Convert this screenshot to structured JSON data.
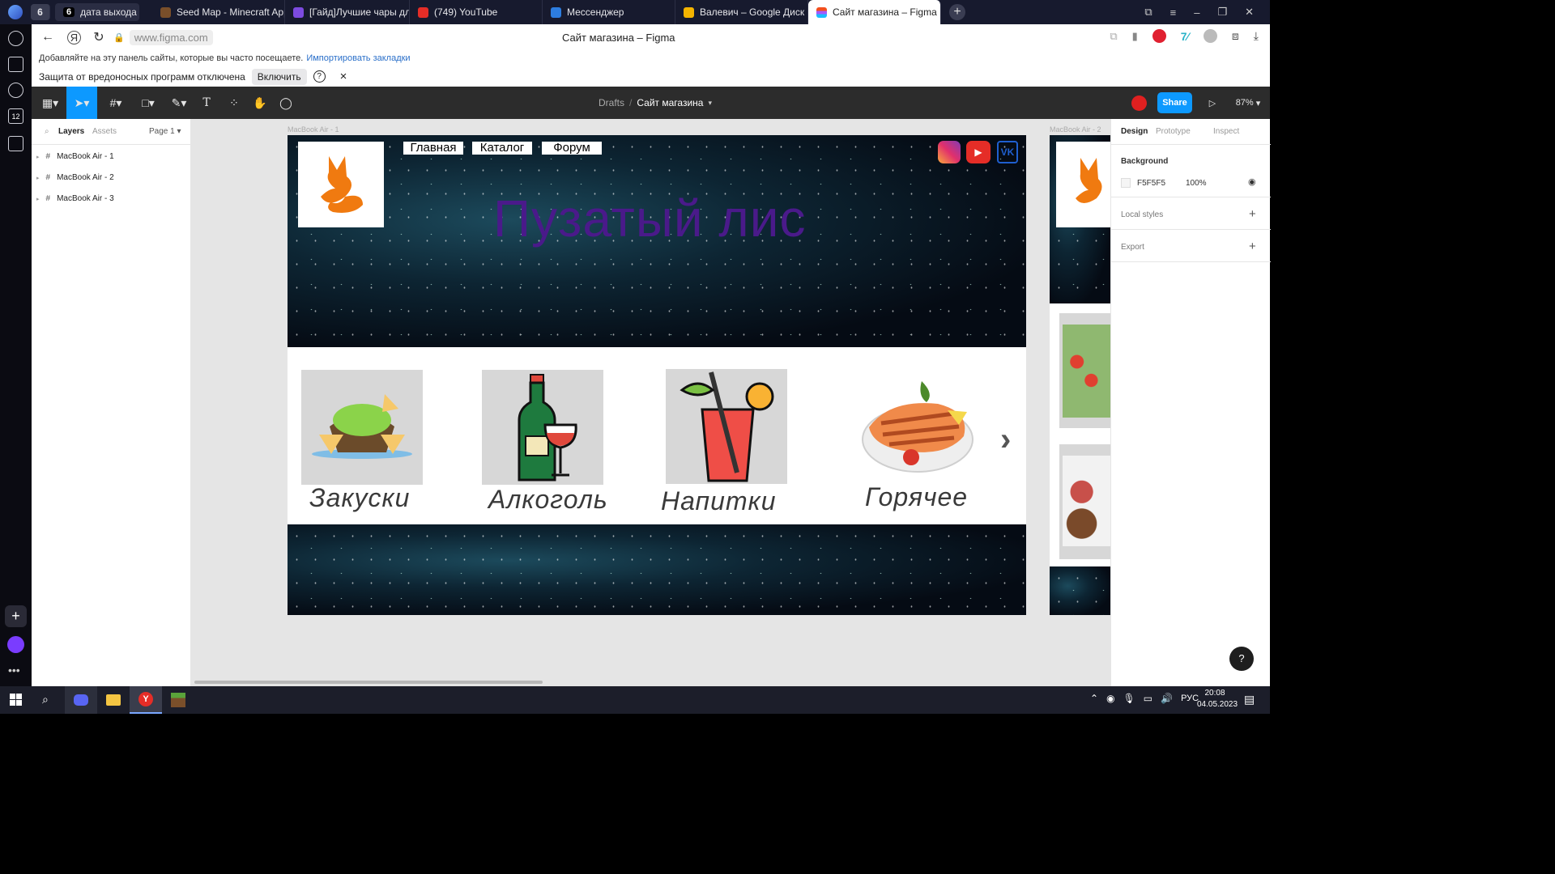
{
  "tabs": [
    {
      "label": "6",
      "fav": "#ffffff"
    },
    {
      "label": "дата выхода",
      "count": "6"
    },
    {
      "label": "Seed Map - Minecraft App",
      "fav": "#7a4f2a"
    },
    {
      "label": "[Гайд]Лучшие чары для в",
      "fav": "#7d4be0"
    },
    {
      "label": "(749) YouTube",
      "fav": "#e52d27"
    },
    {
      "label": "Мессенджер",
      "fav": "#2d7de0"
    },
    {
      "label": "Валевич – Google Диск",
      "fav": "#f4b400"
    },
    {
      "label": "Сайт магазина – Figma",
      "fav": "#f24e1e"
    }
  ],
  "browser": {
    "url": "www.figma.com",
    "title": "Сайт магазина – Figma",
    "bookmarks_hint": "Добавляйте на эту панель сайты, которые вы часто посещаете.",
    "import_link": "Импортировать закладки",
    "protection_text": "Защита от вредоносных программ отключена",
    "enable_label": "Включить",
    "help": "?",
    "close": "×"
  },
  "figma": {
    "breadcrumb_drafts": "Drafts",
    "breadcrumb_sep": "/",
    "file_name": "Сайт магазина",
    "share": "Share",
    "zoom": "87%",
    "layers_tab": "Layers",
    "assets_tab": "Assets",
    "page": "Page 1",
    "layers": [
      "MacBook Air - 1",
      "MacBook Air - 2",
      "MacBook Air - 3"
    ],
    "frame_label_1": "MacBook Air - 1",
    "frame_label_2": "MacBook Air - 2",
    "design_tab": "Design",
    "prototype_tab": "Prototype",
    "inspect_tab": "Inspect",
    "background_label": "Background",
    "bg_hex": "F5F5F5",
    "bg_opacity": "100%",
    "local_styles": "Local styles",
    "export": "Export",
    "help": "?"
  },
  "site": {
    "nav": [
      "Главная",
      "Каталог",
      "Форум"
    ],
    "title": "Пузатый лис",
    "title_color": "#4a1a8a",
    "categories": [
      "Закуски",
      "Алкоголь",
      "Напитки",
      "Горячее"
    ],
    "next": "›"
  },
  "sidebar_badge": "12",
  "taskbar": {
    "lang": "РУС",
    "time": "20:08",
    "date": "04.05.2023"
  }
}
